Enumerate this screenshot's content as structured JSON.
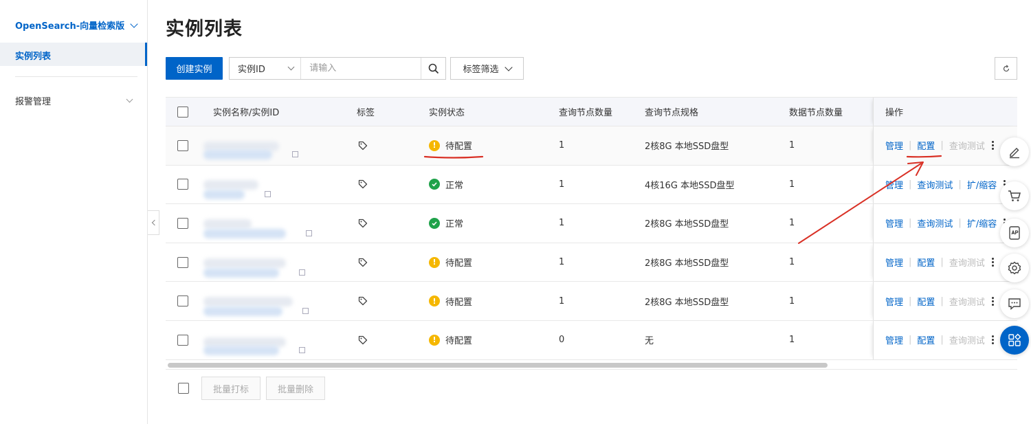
{
  "sidebar": {
    "product": "OpenSearch-向量检索版",
    "items": [
      {
        "label": "实例列表"
      },
      {
        "label": "报警管理"
      }
    ]
  },
  "page": {
    "title": "实例列表"
  },
  "toolbar": {
    "create_label": "创建实例",
    "search_field": "实例ID",
    "search_placeholder": "请输入",
    "tag_filter_label": "标签筛选"
  },
  "table": {
    "columns": [
      "实例名称/实例ID",
      "标签",
      "实例状态",
      "查询节点数量",
      "查询节点规格",
      "数据节点数量",
      "操作"
    ],
    "rows": [
      {
        "status": "待配置",
        "status_kind": "warn",
        "query_nodes": "1",
        "spec": "2核8G 本地SSD盘型",
        "data_nodes": "1",
        "ops": [
          {
            "label": "管理",
            "enabled": true
          },
          {
            "label": "配置",
            "enabled": true
          },
          {
            "label": "查询测试",
            "enabled": false
          }
        ]
      },
      {
        "status": "正常",
        "status_kind": "ok",
        "query_nodes": "1",
        "spec": "4核16G 本地SSD盘型",
        "data_nodes": "1",
        "ops": [
          {
            "label": "管理",
            "enabled": true
          },
          {
            "label": "查询测试",
            "enabled": true
          },
          {
            "label": "扩/缩容",
            "enabled": true
          }
        ]
      },
      {
        "status": "正常",
        "status_kind": "ok",
        "query_nodes": "1",
        "spec": "2核8G 本地SSD盘型",
        "data_nodes": "1",
        "ops": [
          {
            "label": "管理",
            "enabled": true
          },
          {
            "label": "查询测试",
            "enabled": true
          },
          {
            "label": "扩/缩容",
            "enabled": true
          }
        ]
      },
      {
        "status": "待配置",
        "status_kind": "warn",
        "query_nodes": "1",
        "spec": "2核8G 本地SSD盘型",
        "data_nodes": "1",
        "ops": [
          {
            "label": "管理",
            "enabled": true
          },
          {
            "label": "配置",
            "enabled": true
          },
          {
            "label": "查询测试",
            "enabled": false
          }
        ]
      },
      {
        "status": "待配置",
        "status_kind": "warn",
        "query_nodes": "1",
        "spec": "2核8G 本地SSD盘型",
        "data_nodes": "1",
        "ops": [
          {
            "label": "管理",
            "enabled": true
          },
          {
            "label": "配置",
            "enabled": true
          },
          {
            "label": "查询测试",
            "enabled": false
          }
        ]
      },
      {
        "status": "待配置",
        "status_kind": "warn",
        "query_nodes": "0",
        "spec": "无",
        "data_nodes": "1",
        "ops": [
          {
            "label": "管理",
            "enabled": true
          },
          {
            "label": "配置",
            "enabled": true
          },
          {
            "label": "查询测试",
            "enabled": false
          }
        ]
      }
    ]
  },
  "footer": {
    "batch_tag_label": "批量打标",
    "batch_delete_label": "批量删除"
  },
  "floating_toolbar": [
    "edit-icon",
    "cart-icon",
    "api-icon",
    "gear-icon",
    "feedback-icon",
    "apps-icon"
  ],
  "colors": {
    "brand": "#0064c8",
    "warn": "#f5b700",
    "ok": "#1fa24a",
    "annotation": "#d93025"
  }
}
